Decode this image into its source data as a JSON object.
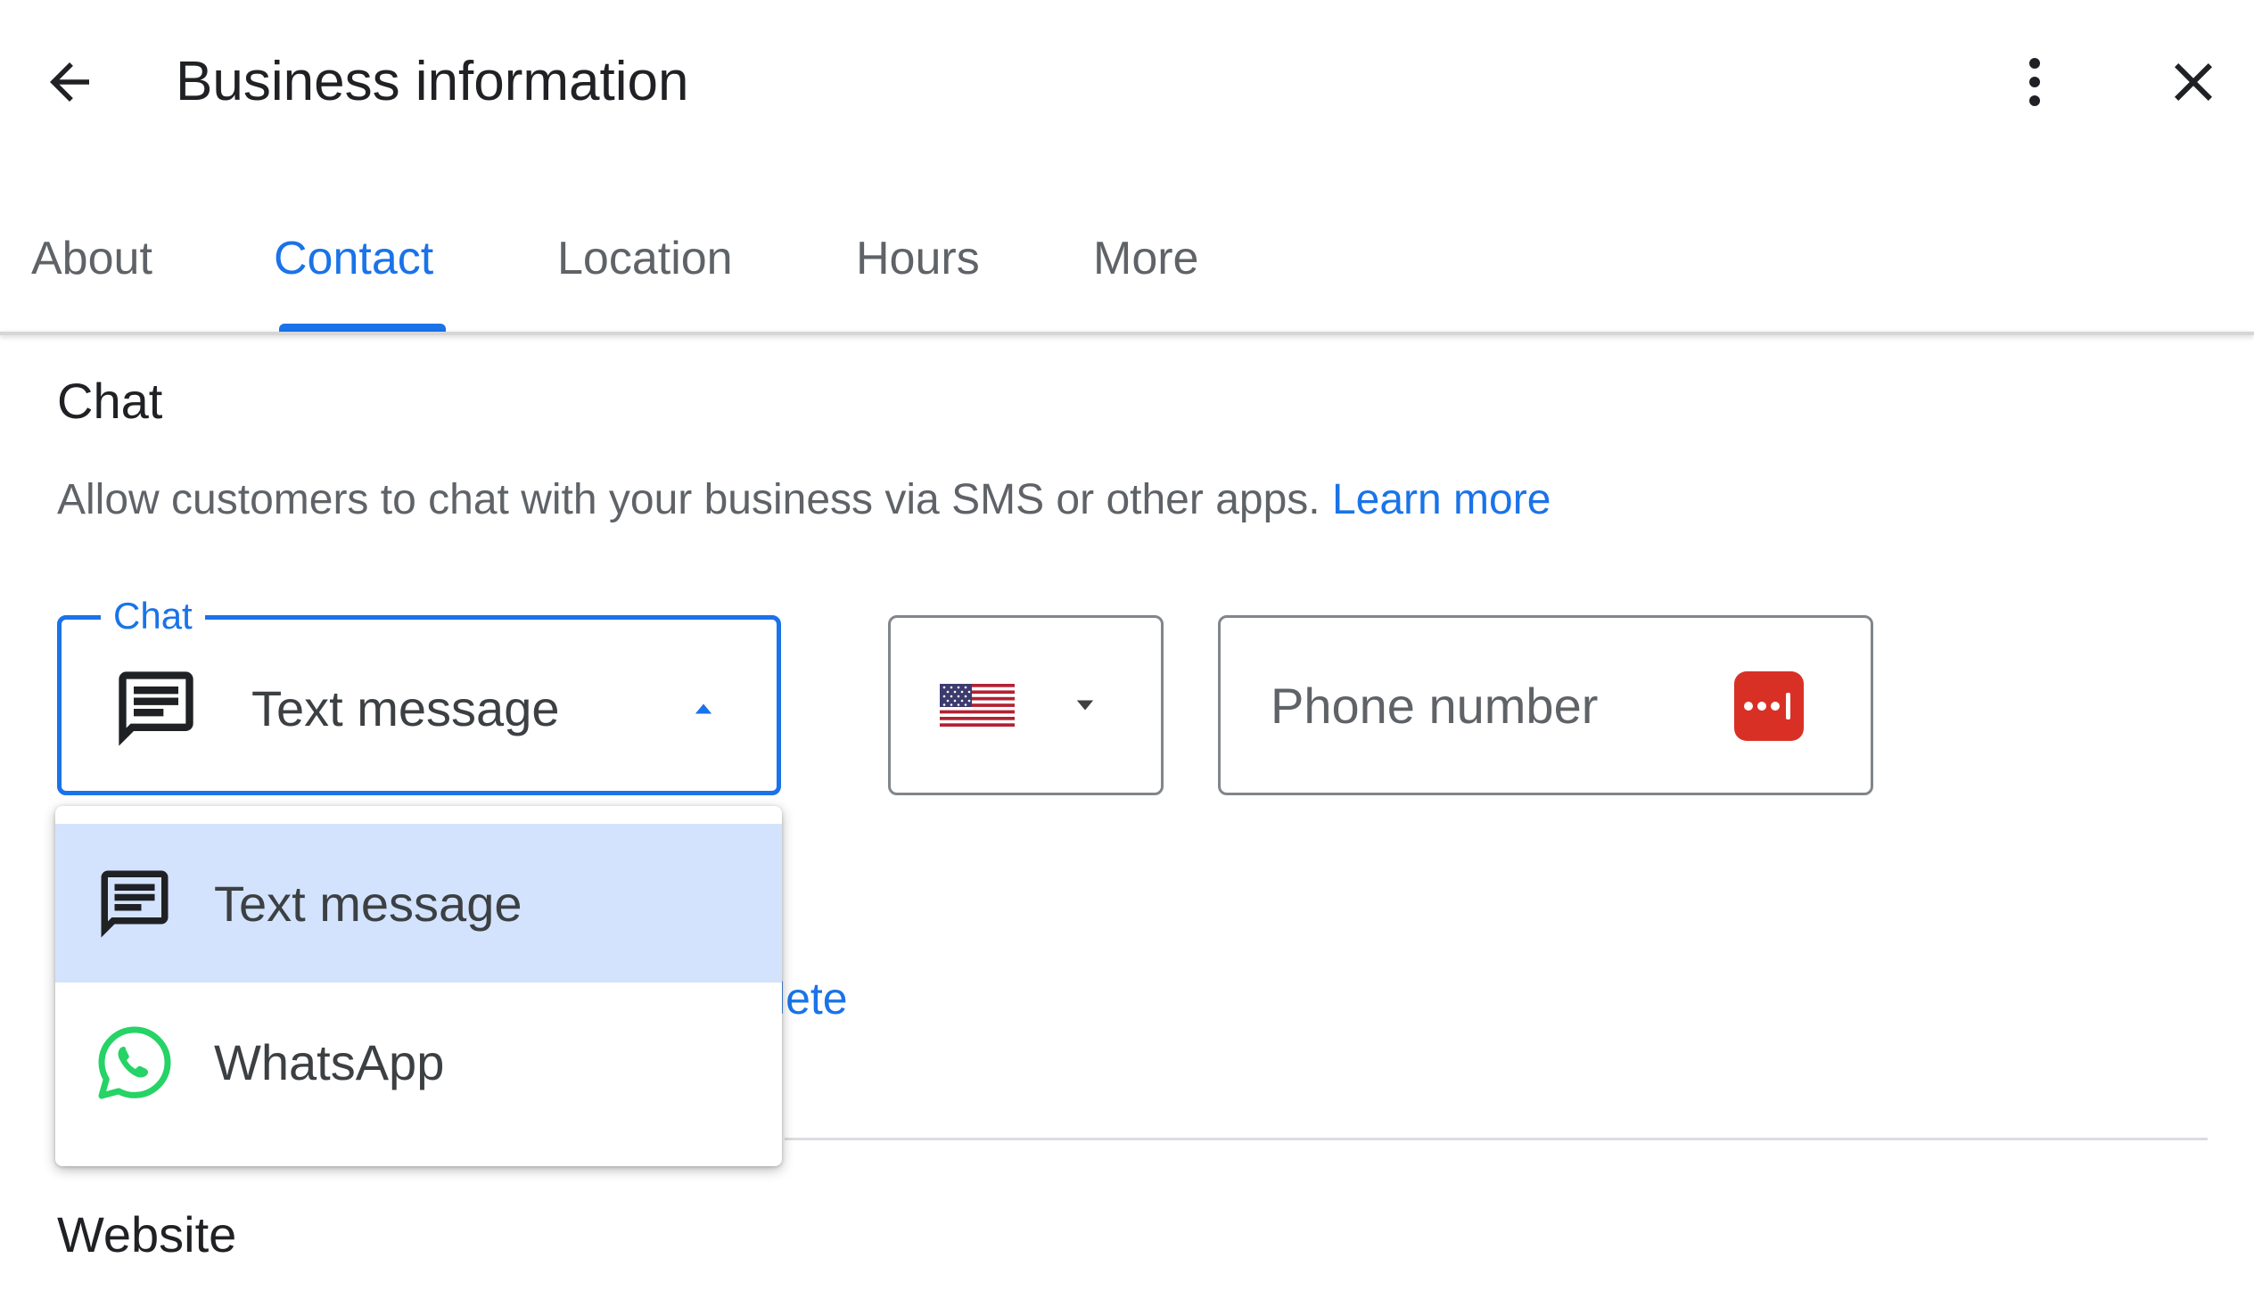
{
  "header": {
    "title": "Business information"
  },
  "tabs": [
    {
      "label": "About"
    },
    {
      "label": "Contact"
    },
    {
      "label": "Location"
    },
    {
      "label": "Hours"
    },
    {
      "label": "More"
    }
  ],
  "active_tab": "Contact",
  "chat_section": {
    "title": "Chat",
    "description": "Allow customers to chat with your business via SMS or other apps.",
    "learn_more": "Learn more",
    "select_label": "Chat",
    "select_value": "Text message",
    "phone_placeholder": "Phone number",
    "country": "United States",
    "partial_link": "lete",
    "options": [
      {
        "label": "Text message",
        "icon": "sms-icon"
      },
      {
        "label": "WhatsApp",
        "icon": "whatsapp-icon"
      }
    ]
  },
  "website_section": {
    "title": "Website"
  },
  "colors": {
    "accent": "#1a73e8",
    "selected_option_bg": "#d3e3fd",
    "password_manager_icon": "#d93025",
    "whatsapp": "#25d366"
  }
}
